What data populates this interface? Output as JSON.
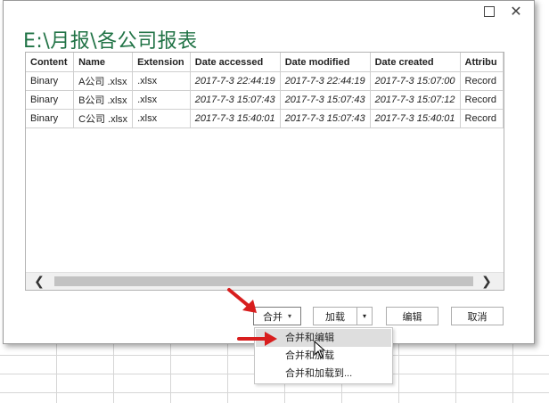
{
  "dialog": {
    "title_path": "E:\\月报\\各公司报表",
    "window_controls": {
      "maximize_icon": "maximize-icon",
      "close_icon": "close-icon",
      "close_glyph": "✕"
    }
  },
  "table": {
    "headers": [
      "Content",
      "Name",
      "Extension",
      "Date accessed",
      "Date modified",
      "Date created",
      "Attribu"
    ],
    "rows": [
      [
        "Binary",
        "A公司 .xlsx",
        ".xlsx",
        "2017-7-3 22:44:19",
        "2017-7-3 22:44:19",
        "2017-7-3 15:07:00",
        "Record"
      ],
      [
        "Binary",
        "B公司 .xlsx",
        ".xlsx",
        "2017-7-3 15:07:43",
        "2017-7-3 15:07:43",
        "2017-7-3 15:07:12",
        "Record"
      ],
      [
        "Binary",
        "C公司 .xlsx",
        ".xlsx",
        "2017-7-3 15:40:01",
        "2017-7-3 15:07:43",
        "2017-7-3 15:40:01",
        "Record"
      ]
    ],
    "scroll_left": "❮",
    "scroll_right": "❯"
  },
  "buttons": {
    "combine": "合并",
    "combine_caret": "▾",
    "load": "加载",
    "load_caret": "▾",
    "edit": "编辑",
    "cancel": "取消"
  },
  "menu": {
    "items": [
      "合并和编辑",
      "合并和加载",
      "合并和加载到..."
    ]
  },
  "colors": {
    "title_green": "#217346",
    "arrow_red": "#d81e1e",
    "highlight": "#dedede"
  }
}
